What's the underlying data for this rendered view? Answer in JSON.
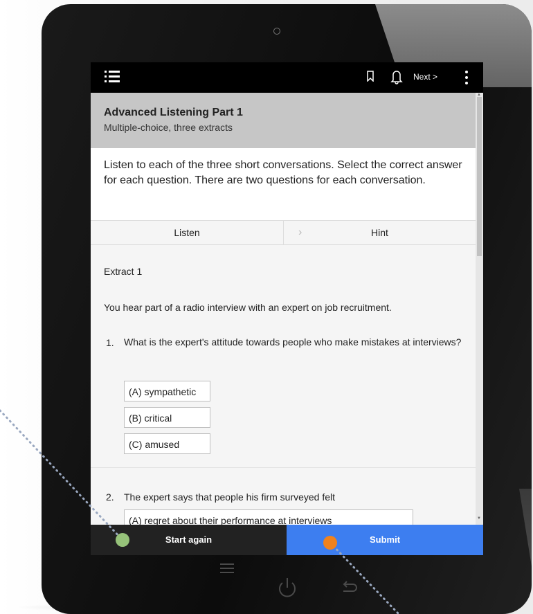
{
  "topbar": {
    "next_label": "Next >"
  },
  "header": {
    "title": "Advanced Listening Part 1",
    "subtitle": "Multiple-choice, three extracts"
  },
  "intro": {
    "text": "Listen to each of the three short conversations. Select the correct answer for each question. There are two questions for each conversation."
  },
  "tabs": {
    "listen": "Listen",
    "hint": "Hint"
  },
  "content": {
    "extract_title": "Extract 1",
    "description": "You hear part of a radio interview with an expert on job recruitment.",
    "questions": [
      {
        "number": "1.",
        "text": "What is the expert's attitude towards people who make mistakes at interviews?",
        "options": [
          "(A) sympathetic",
          "(B) critical",
          "(C) amused"
        ]
      },
      {
        "number": "2.",
        "text": "The expert says that people his firm surveyed felt",
        "options": [
          "(A) regret about their performance at interviews"
        ]
      }
    ]
  },
  "bottombar": {
    "start_again": "Start again",
    "submit": "Submit"
  },
  "colors": {
    "submit_blue": "#3d7ef0",
    "green_marker": "#96c27a",
    "orange_marker": "#f0821e"
  }
}
